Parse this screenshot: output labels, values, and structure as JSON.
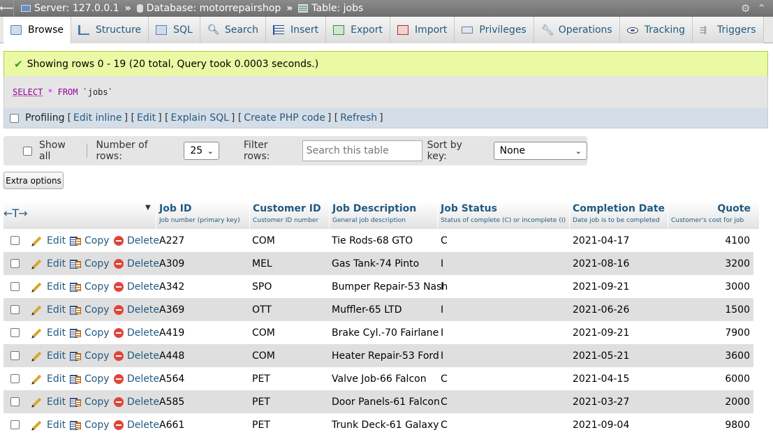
{
  "topbar": {
    "server": "Server: 127.0.0.1",
    "database": "Database: motorrepairshop",
    "table": "Table: jobs",
    "separator": "»"
  },
  "tabs": [
    {
      "label": "Browse",
      "icon": "browse-icon"
    },
    {
      "label": "Structure",
      "icon": "structure-icon"
    },
    {
      "label": "SQL",
      "icon": "sql-icon"
    },
    {
      "label": "Search",
      "icon": "search-icon"
    },
    {
      "label": "Insert",
      "icon": "insert-icon"
    },
    {
      "label": "Export",
      "icon": "export-icon"
    },
    {
      "label": "Import",
      "icon": "import-icon"
    },
    {
      "label": "Privileges",
      "icon": "privileges-icon"
    },
    {
      "label": "Operations",
      "icon": "wrench-icon"
    },
    {
      "label": "Tracking",
      "icon": "eye-icon"
    },
    {
      "label": "Triggers",
      "icon": "triggers-icon"
    }
  ],
  "message": {
    "text": "Showing rows 0 - 19 (20 total, Query took 0.0003 seconds.)"
  },
  "query": {
    "select": "SELECT",
    "star": "*",
    "from": "FROM",
    "table": "`jobs`"
  },
  "profiling": {
    "label": "Profiling",
    "edit_inline": "Edit inline",
    "edit": "Edit",
    "explain": "Explain SQL",
    "create_php": "Create PHP code",
    "refresh": "Refresh"
  },
  "nav": {
    "show_all": "Show all",
    "rows_label": "Number of rows:",
    "rows_value": "25",
    "filter_label": "Filter rows:",
    "filter_placeholder": "Search this table",
    "sort_label": "Sort by key:",
    "sort_value": "None"
  },
  "extra_options": "Extra options",
  "actions": {
    "edit": "Edit",
    "copy": "Copy",
    "delete": "Delete"
  },
  "columns": [
    {
      "title": "Job ID",
      "comment": "Job number (primary key)"
    },
    {
      "title": "Customer ID",
      "comment": "Customer ID number"
    },
    {
      "title": "Job Description",
      "comment": "General job description"
    },
    {
      "title": "Job Status",
      "comment": "Status of complete (C) or incomplete (I)"
    },
    {
      "title": "Completion Date",
      "comment": "Date job is to be completed"
    },
    {
      "title": "Quote",
      "comment": "Customer's cost for job"
    }
  ],
  "rows": [
    [
      "A227",
      "COM",
      "Tie Rods-68 GTO",
      "C",
      "2021-04-17",
      "4100"
    ],
    [
      "A309",
      "MEL",
      "Gas Tank-74 Pinto",
      "I",
      "2021-08-16",
      "3200"
    ],
    [
      "A342",
      "SPO",
      "Bumper Repair-53 Nash",
      "I",
      "2021-09-21",
      "3000"
    ],
    [
      "A369",
      "OTT",
      "Muffler-65 LTD",
      "I",
      "2021-06-26",
      "1500"
    ],
    [
      "A419",
      "COM",
      "Brake Cyl.-70 Fairlane",
      "I",
      "2021-09-21",
      "7900"
    ],
    [
      "A448",
      "COM",
      "Heater Repair-53 Ford",
      "I",
      "2021-05-21",
      "3600"
    ],
    [
      "A564",
      "PET",
      "Valve Job-66 Falcon",
      "C",
      "2021-04-15",
      "6000"
    ],
    [
      "A585",
      "PET",
      "Door Panels-61 Falcon",
      "C",
      "2021-03-27",
      "2000"
    ],
    [
      "A661",
      "PET",
      "Trunk Deck-61 Galaxy",
      "C",
      "2021-09-04",
      "9800"
    ]
  ],
  "colors": {
    "link": "#235a81",
    "success_bg": "#ebf8a4",
    "row_alt": "#dfdfdf"
  }
}
